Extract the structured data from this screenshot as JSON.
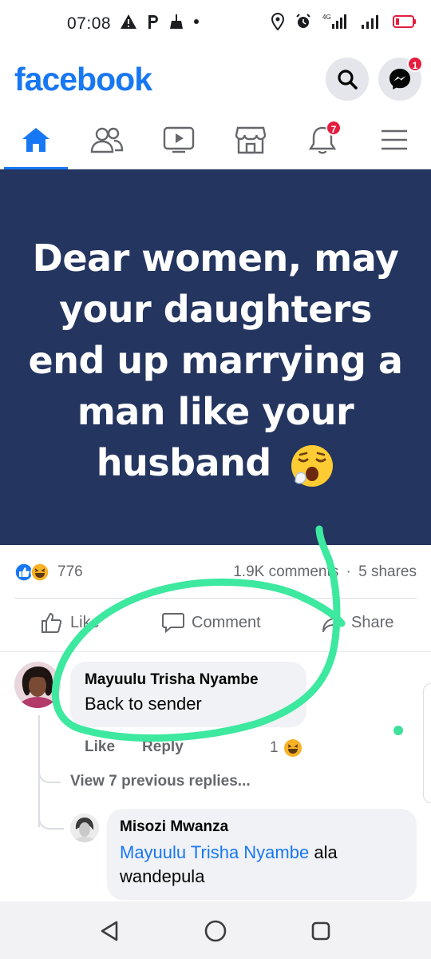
{
  "status_bar": {
    "time": "07:08",
    "left_icons": [
      "warning-icon",
      "parking-icon",
      "broom-icon",
      "dot-icon"
    ],
    "right_icons": [
      "location-icon",
      "alarm-icon",
      "signal-4g-icon",
      "signal-bars-icon",
      "battery-low-icon"
    ],
    "network_label": "4G"
  },
  "header": {
    "logo": "facebook",
    "brand_color": "#1877f2",
    "messenger_badge": "1"
  },
  "nav": {
    "tabs": [
      "home",
      "friends",
      "watch",
      "marketplace",
      "notifications",
      "menu"
    ],
    "active": "home",
    "notifications_badge": "7"
  },
  "post": {
    "text": "Dear women, may your daughters end up marrying a man like your husband",
    "background": "#243560",
    "emoji": "yawning-face",
    "reaction_count": "776",
    "comments_label": "1.9K comments",
    "separator": "·",
    "shares_label": "5 shares",
    "actions": {
      "like": "Like",
      "comment": "Comment",
      "share": "Share"
    }
  },
  "comments": [
    {
      "name": "Mayuulu Trisha Nyambe",
      "text": "Back to sender",
      "like_label": "Like",
      "reply_label": "Reply",
      "reaction_count": "1"
    }
  ],
  "view_previous": "View 7 previous replies...",
  "reply": {
    "name": "Misozi Mwanza",
    "mention": "Mayuulu Trisha Nyambe",
    "text": " ala wandepula"
  },
  "annotation_color": "#3de89f"
}
